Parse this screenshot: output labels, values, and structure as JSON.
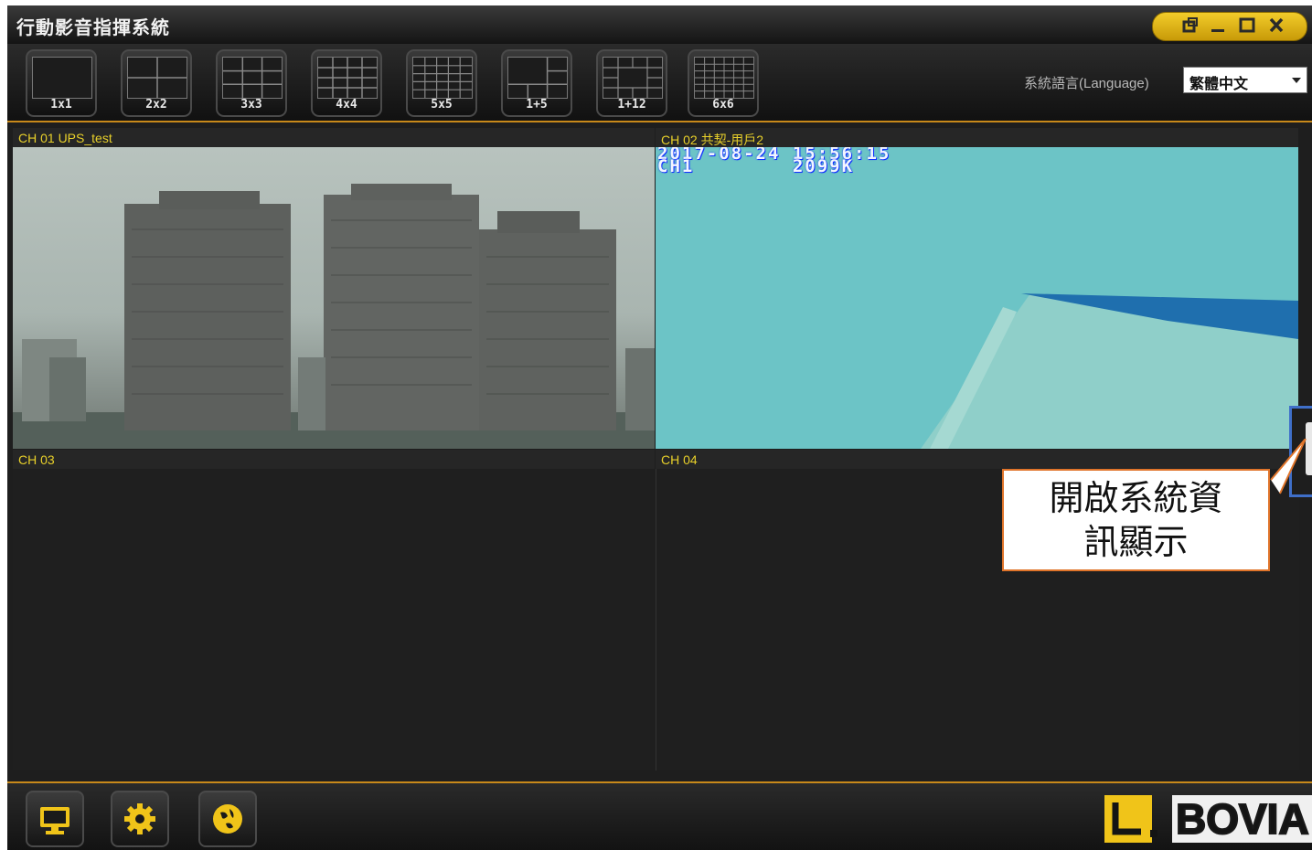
{
  "window": {
    "title": "行動影音指揮系統"
  },
  "layouts": [
    {
      "label": "1x1"
    },
    {
      "label": "2x2"
    },
    {
      "label": "3x3"
    },
    {
      "label": "4x4"
    },
    {
      "label": "5x5"
    },
    {
      "label": "1+5"
    },
    {
      "label": "1+12"
    },
    {
      "label": "6x6"
    }
  ],
  "language": {
    "label": "系統語言(Language)",
    "selected": "繁體中文"
  },
  "channels": [
    {
      "label": "CH 01 UPS_test"
    },
    {
      "label": "CH 02 共契-用戶2",
      "osd_line1": "2017-08-24 15:56:15",
      "osd_line2": "CH1        2099K"
    },
    {
      "label": "CH 03"
    },
    {
      "label": "CH 04"
    }
  ],
  "bottom_icons": [
    "monitor-icon",
    "gear-icon",
    "globe-icon"
  ],
  "logo": {
    "text": "BOVIA"
  },
  "callout": {
    "text": "開啟系統資訊顯示"
  },
  "colors": {
    "accent": "#c8891a",
    "channel_label": "#e8d02a",
    "button_yellow": "#f0c419",
    "panel_bg": "#1e1e1e"
  }
}
